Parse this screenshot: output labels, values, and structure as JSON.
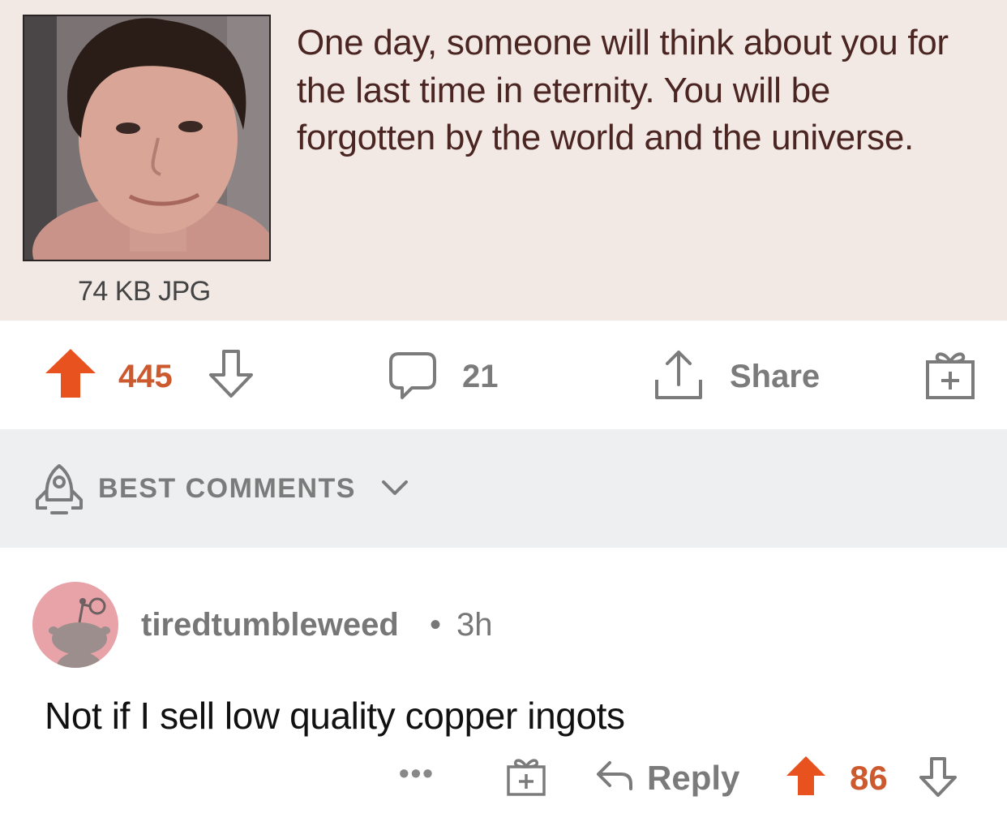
{
  "post": {
    "text_lines": [
      "One day, someone will think about you for",
      "the last time in eternity. You will be",
      "forgotten by the world and the universe."
    ],
    "file_info": "74 KB JPG"
  },
  "actions": {
    "upvotes": "445",
    "comments": "21",
    "share_label": "Share"
  },
  "sort": {
    "label": "BEST COMMENTS"
  },
  "comment": {
    "username": "tiredtumbleweed",
    "separator": "•",
    "time": "3h",
    "body": "Not if I sell low quality copper ingots",
    "more_label": "•••",
    "reply_label": "Reply",
    "upvotes": "86"
  },
  "colors": {
    "upvote": "#e8521f",
    "post_panel_bg": "#f2e9e5",
    "sort_bar_bg": "#edeff0",
    "avatar_bg": "#e8a3a8"
  }
}
